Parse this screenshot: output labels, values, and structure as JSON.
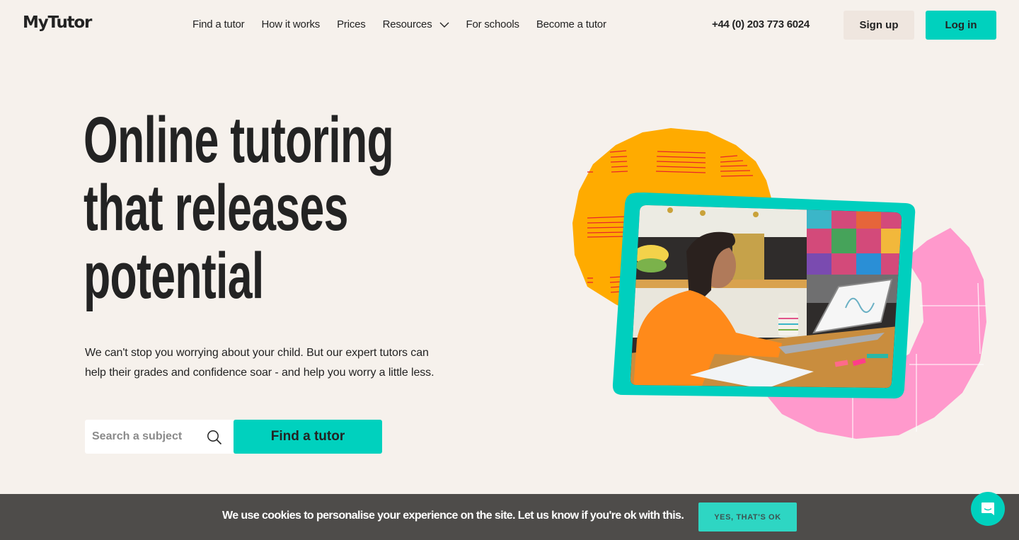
{
  "nav": {
    "logo": "MyTutor",
    "links": [
      {
        "label": "Find a tutor"
      },
      {
        "label": "How it works"
      },
      {
        "label": "Prices"
      },
      {
        "label": "Resources",
        "icon": "chevron-down-icon"
      },
      {
        "label": "For schools"
      },
      {
        "label": "Become a tutor"
      }
    ],
    "phone": "+44 (0) 203 773 6024",
    "signup_label": "Sign up",
    "login_label": "Log in"
  },
  "hero": {
    "title_lines": [
      "Online tutoring",
      "that releases",
      "potential"
    ],
    "subtitle": "We can't stop you worrying about your child. But our expert tutors can help their grades and confidence soar - and help you worry a little less.",
    "search": {
      "placeholder": "Search a subject",
      "value": "",
      "icon": "search-icon"
    },
    "cta_label": "Find a tutor",
    "illustration": {
      "description": "Student in orange sweatshirt studying at kitchen table with laptop showing online tutor",
      "shapes": [
        "orange-circle",
        "pink-ring",
        "teal-photo-frame"
      ]
    }
  },
  "cookie_banner": {
    "text": "We use cookies to personalise your experience on the site. Let us know if you're ok with this.",
    "accept_label": "YES, THAT'S OK"
  },
  "chat": {
    "icon": "chat-bubble-icon"
  },
  "colors": {
    "background": "#f6f1ec",
    "accent_teal": "#00d1be",
    "signup_bg": "#efe6df",
    "text": "#232323",
    "cookie_bar": "#4e4c4a",
    "orange": "#ffab00",
    "pink": "#ff99cc",
    "stripe_red": "#e8262a"
  }
}
